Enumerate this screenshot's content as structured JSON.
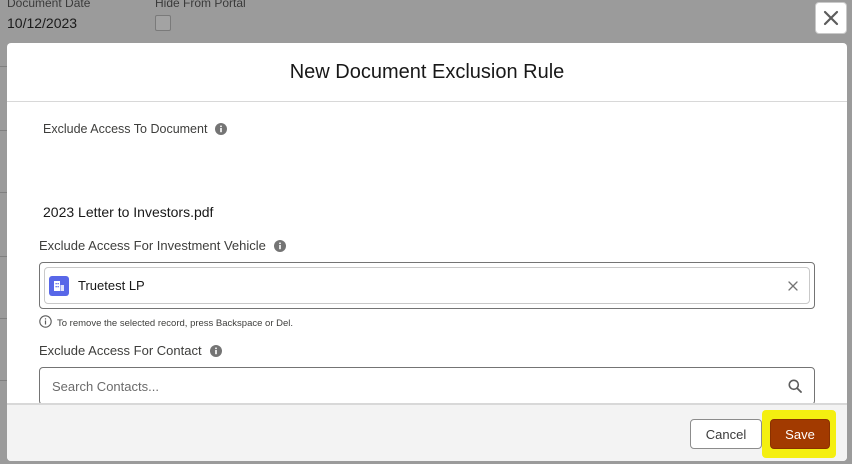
{
  "background": {
    "fields": [
      {
        "label": "Document Date",
        "value": "10/12/2023"
      },
      {
        "label": "Hide From Portal",
        "value": ""
      }
    ]
  },
  "modal": {
    "title": "New Document Exclusion Rule",
    "document_label": "Exclude Access To Document",
    "document_value": "2023 Letter to Investors.pdf",
    "vehicle_label": "Exclude Access For Investment Vehicle",
    "vehicle_selected": "Truetest LP",
    "vehicle_help": "To remove the selected record, press Backspace or Del.",
    "contact_label": "Exclude Access For Contact",
    "contact_placeholder": "Search Contacts...",
    "cancel_label": "Cancel",
    "save_label": "Save"
  },
  "colors": {
    "save_button": "#a23a00",
    "highlight": "#f4ef10",
    "record_icon": "#5867e8"
  },
  "icons": [
    "close-icon",
    "info-icon",
    "record-icon",
    "remove-icon",
    "search-icon"
  ]
}
